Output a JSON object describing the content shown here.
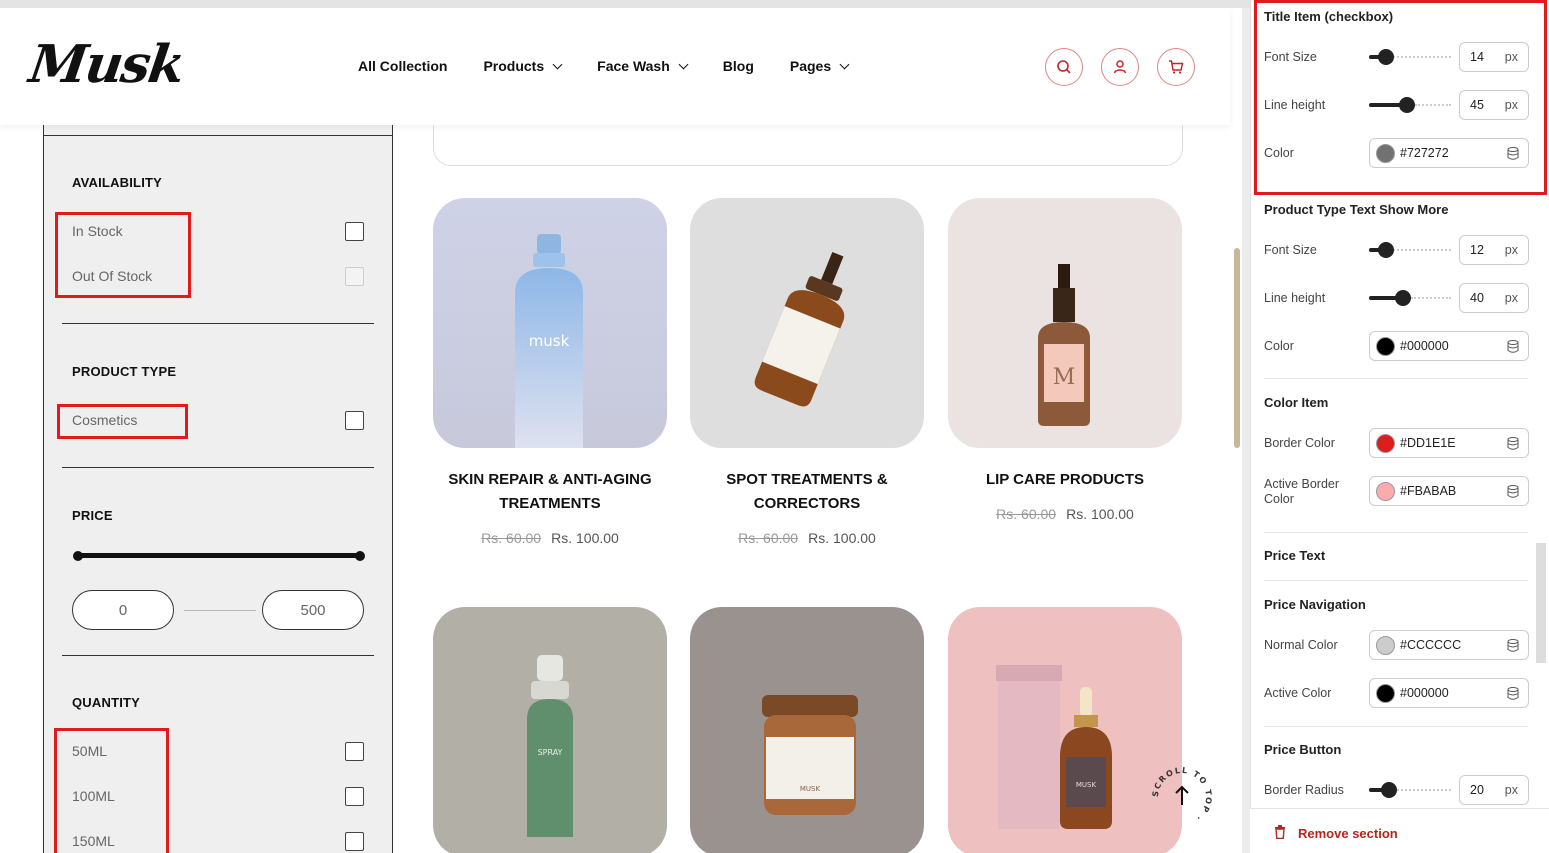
{
  "brand": {
    "logo": "Musk"
  },
  "nav": {
    "items": [
      {
        "label": "All Collection",
        "has_dropdown": false
      },
      {
        "label": "Products",
        "has_dropdown": true
      },
      {
        "label": "Face Wash",
        "has_dropdown": true
      },
      {
        "label": "Blog",
        "has_dropdown": false
      },
      {
        "label": "Pages",
        "has_dropdown": true
      }
    ],
    "icons": [
      "search-icon",
      "user-icon",
      "cart-icon"
    ]
  },
  "filters": {
    "availability": {
      "title": "AVAILABILITY",
      "options": [
        "In Stock",
        "Out Of Stock"
      ]
    },
    "product_type": {
      "title": "PRODUCT TYPE",
      "options": [
        "Cosmetics"
      ]
    },
    "price": {
      "title": "PRICE",
      "min": "0",
      "max": "500",
      "range_fraction": [
        0,
        1
      ]
    },
    "quantity": {
      "title": "QUANTITY",
      "options": [
        "50ML",
        "100ML",
        "150ML"
      ]
    }
  },
  "products": [
    {
      "title_line1": "SKIN REPAIR & ANTI-AGING",
      "title_line2": "TREATMENTS",
      "old_price": "Rs. 60.00",
      "price": "Rs. 100.00",
      "image_label": "musk"
    },
    {
      "title_line1": "SPOT TREATMENTS &",
      "title_line2": "CORRECTORS",
      "old_price": "Rs. 60.00",
      "price": "Rs. 100.00",
      "image_label": ""
    },
    {
      "title_line1": "LIP CARE PRODUCTS",
      "title_line2": "",
      "old_price": "Rs. 60.00",
      "price": "Rs. 100.00",
      "image_label": "M"
    },
    {
      "title_line1": "",
      "title_line2": "",
      "old_price": "",
      "price": "",
      "image_label": "SPRAY"
    },
    {
      "title_line1": "",
      "title_line2": "",
      "old_price": "",
      "price": "",
      "image_label": "MUSK"
    },
    {
      "title_line1": "",
      "title_line2": "",
      "old_price": "",
      "price": "",
      "image_label": "MUSK"
    }
  ],
  "scroll_to_top": {
    "label": "SCROLL TO TOP ·"
  },
  "panel": {
    "title_item": {
      "heading": "Title Item (checkbox)",
      "font_size": {
        "label": "Font Size",
        "value": "14",
        "unit": "px",
        "fraction": 0.2
      },
      "line_height": {
        "label": "Line height",
        "value": "45",
        "unit": "px",
        "fraction": 0.45
      },
      "color": {
        "label": "Color",
        "hex": "#727272"
      }
    },
    "product_type_text": {
      "heading": "Product Type Text Show More",
      "font_size": {
        "label": "Font Size",
        "value": "12",
        "unit": "px",
        "fraction": 0.2
      },
      "line_height": {
        "label": "Line height",
        "value": "40",
        "unit": "px",
        "fraction": 0.42
      },
      "color": {
        "label": "Color",
        "hex": "#000000"
      }
    },
    "color_item": {
      "heading": "Color Item",
      "border_color": {
        "label": "Border Color",
        "hex": "#DD1E1E"
      },
      "active_border_color": {
        "label_line1": "Active Border",
        "label_line2": "Color",
        "hex": "#FBABAB"
      }
    },
    "price_text": {
      "heading": "Price Text"
    },
    "price_navigation": {
      "heading": "Price Navigation",
      "normal_color": {
        "label": "Normal Color",
        "hex": "#CCCCCC"
      },
      "active_color": {
        "label": "Active Color",
        "hex": "#000000"
      }
    },
    "price_button": {
      "heading": "Price Button",
      "border_radius": {
        "label": "Border Radius",
        "value": "20",
        "unit": "px",
        "fraction": 0.25
      }
    },
    "remove_section": {
      "label": "Remove section"
    }
  },
  "colors": {
    "highlight": "#e01b1b",
    "accent_red": "#b3261e",
    "scrollbar": "#c8b89a"
  }
}
